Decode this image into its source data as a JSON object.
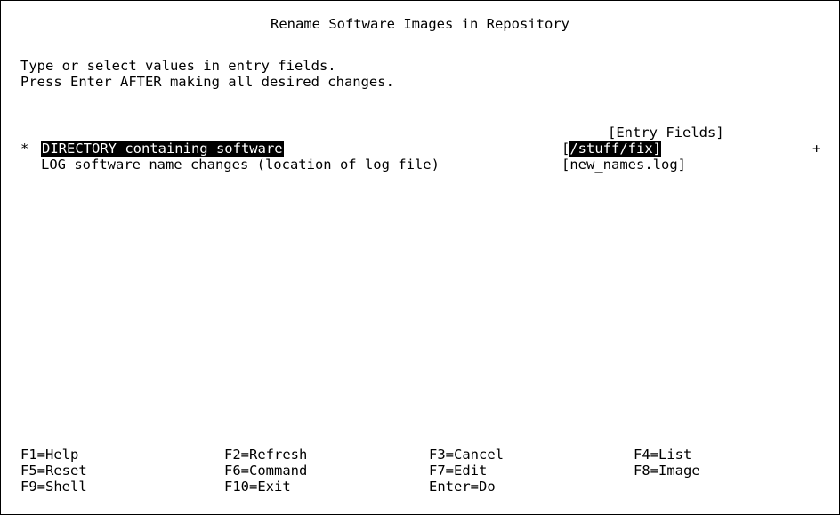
{
  "screen": {
    "title": "Rename Software Images in Repository",
    "instructions": [
      "Type or select values in entry fields.",
      "Press Enter AFTER making all desired changes."
    ],
    "entry_fields_header": "[Entry Fields]"
  },
  "fields": [
    {
      "required_marker": "*",
      "label": "DIRECTORY containing software",
      "bracket_open": "[",
      "value": "/stuff/fix]",
      "bracket_close": "",
      "list_indicator": "+",
      "selected": true
    },
    {
      "required_marker": "",
      "label": "LOG software name changes (location of log file)",
      "bracket_open": "[",
      "value": "new_names.log",
      "bracket_close": "]",
      "list_indicator": "",
      "selected": false
    }
  ],
  "function_keys": [
    [
      "F1=Help",
      "F2=Refresh",
      "F3=Cancel",
      "F4=List"
    ],
    [
      "F5=Reset",
      "F6=Command",
      "F7=Edit",
      "F8=Image"
    ],
    [
      "F9=Shell",
      "F10=Exit",
      "Enter=Do",
      ""
    ]
  ],
  "colors": {
    "background": "#ffffff",
    "text": "#000000",
    "highlight_bg": "#000000",
    "highlight_text": "#ffffff"
  }
}
